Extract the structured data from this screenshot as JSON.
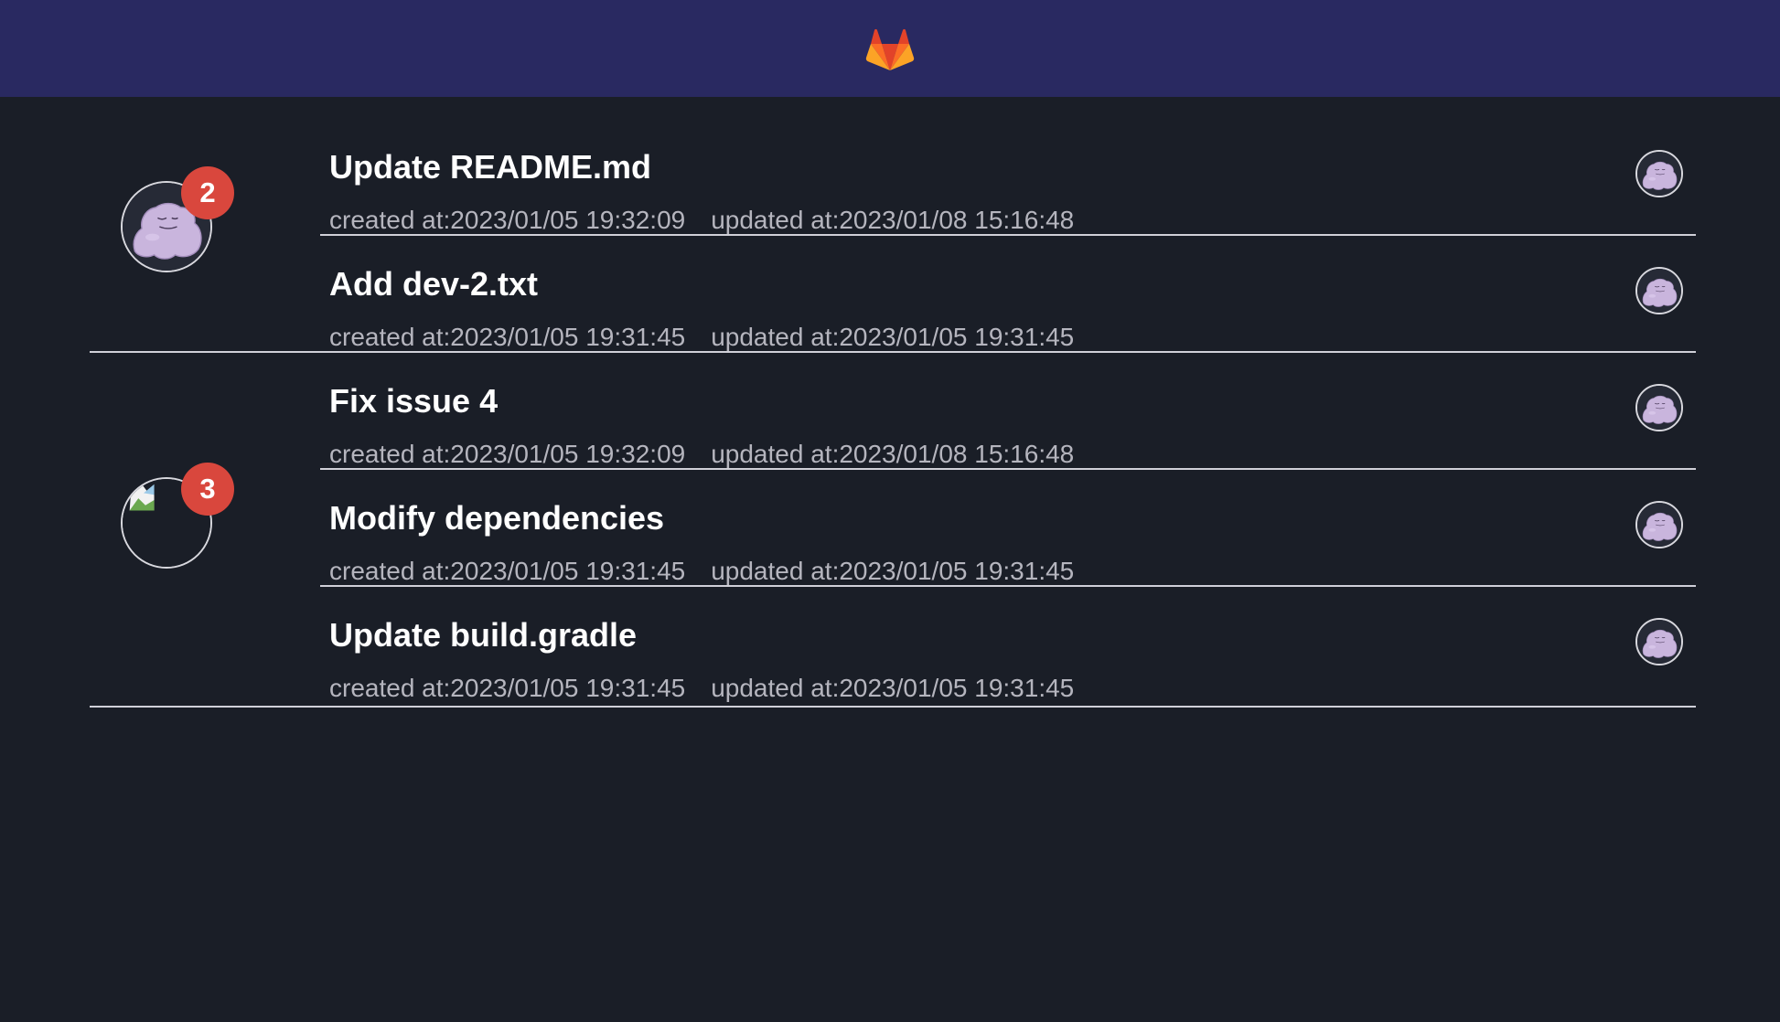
{
  "header": {
    "logo_icon": "gitlab-logo-icon",
    "background": "#292961"
  },
  "groups": [
    {
      "count": "2",
      "avatar_icon": "ditto-avatar-icon",
      "items": [
        {
          "title": "Update README.md",
          "created": "created at:2023/01/05 19:32:09",
          "updated": "updated at:2023/01/08 15:16:48",
          "avatar_icon": "ditto-avatar-icon"
        },
        {
          "title": "Add dev-2.txt",
          "created": "created at:2023/01/05 19:31:45",
          "updated": "updated at:2023/01/05 19:31:45",
          "avatar_icon": "ditto-avatar-icon"
        }
      ]
    },
    {
      "count": "3",
      "avatar_icon": "broken-image-icon",
      "items": [
        {
          "title": "Fix issue 4",
          "created": "created at:2023/01/05 19:32:09",
          "updated": "updated at:2023/01/08 15:16:48",
          "avatar_icon": "ditto-avatar-icon"
        },
        {
          "title": "Modify dependencies",
          "created": "created at:2023/01/05 19:31:45",
          "updated": "updated at:2023/01/05 19:31:45",
          "avatar_icon": "ditto-avatar-icon"
        },
        {
          "title": "Update build.gradle",
          "created": "created at:2023/01/05 19:31:45",
          "updated": "updated at:2023/01/05 19:31:45",
          "avatar_icon": "ditto-avatar-icon"
        }
      ]
    }
  ],
  "colors": {
    "background": "#1a1e27",
    "badge": "#d9473d",
    "divider": "#d0d0d8",
    "meta_text": "#b5b5be"
  }
}
